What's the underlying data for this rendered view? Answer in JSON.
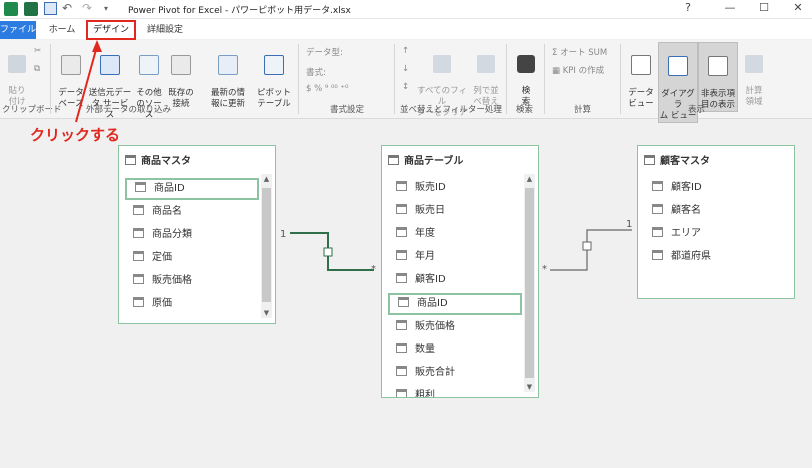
{
  "window": {
    "title": "Power Pivot for Excel - パワーピボット用データ.xlsx",
    "help": "?",
    "minimize": "—",
    "maximize": "☐",
    "close": "✕"
  },
  "tabs": {
    "file": "ファイル",
    "home": "ホーム",
    "design": "デザイン",
    "advanced": "詳細設定"
  },
  "ribbon": {
    "paste": "貼り\n付け",
    "data_source": "データ\nベース",
    "data_service": "送信元デー\nタ サービス",
    "other_source": "その他\nのソース",
    "existing": "既存の\n接続",
    "refresh": "最新の情\n報に更新",
    "pivot": "ピボット\nテーブル",
    "data_type": "データ型:",
    "format": "書式:",
    "currency_symbols": "$ % ⁹ ⁰⁰ ⁺⁰",
    "clear_filters": "すべてのフィル\nターをクリア",
    "sort_by_col": "列で並\nべ替え",
    "find": "検\n索",
    "autosum": "Σ オート SUM",
    "kpi": "KPI の作成",
    "data_view": "データ\nビュー",
    "diagram_view": "ダイアグラ\nム ビュー",
    "show_hidden": "非表示項\n目の表示",
    "calc_area": "計算\n領域",
    "groups": {
      "clipboard": "クリップボード",
      "external": "外部データの取り込み",
      "format": "書式設定",
      "sort_filter": "並べ替えとフィルター処理",
      "find": "検索",
      "calc": "計算",
      "view": "表示"
    }
  },
  "annotation": "クリックする",
  "tables": {
    "product_master": {
      "title": "商品マスタ",
      "fields": [
        "商品ID",
        "商品名",
        "商品分類",
        "定価",
        "販売価格",
        "原価"
      ]
    },
    "product_table": {
      "title": "商品テーブル",
      "fields": [
        "販売ID",
        "販売日",
        "年度",
        "年月",
        "顧客ID",
        "商品ID",
        "販売価格",
        "数量",
        "販売合計",
        "粗利"
      ]
    },
    "customer_master": {
      "title": "顧客マスタ",
      "fields": [
        "顧客ID",
        "顧客名",
        "エリア",
        "都道府県"
      ]
    }
  },
  "relations": {
    "one": "1",
    "many": "*"
  },
  "colors": {
    "accent": "#2b7be0",
    "annotation": "#e0281f",
    "card_border": "#8cc3a0",
    "relation_line": "#2f6f4a"
  }
}
